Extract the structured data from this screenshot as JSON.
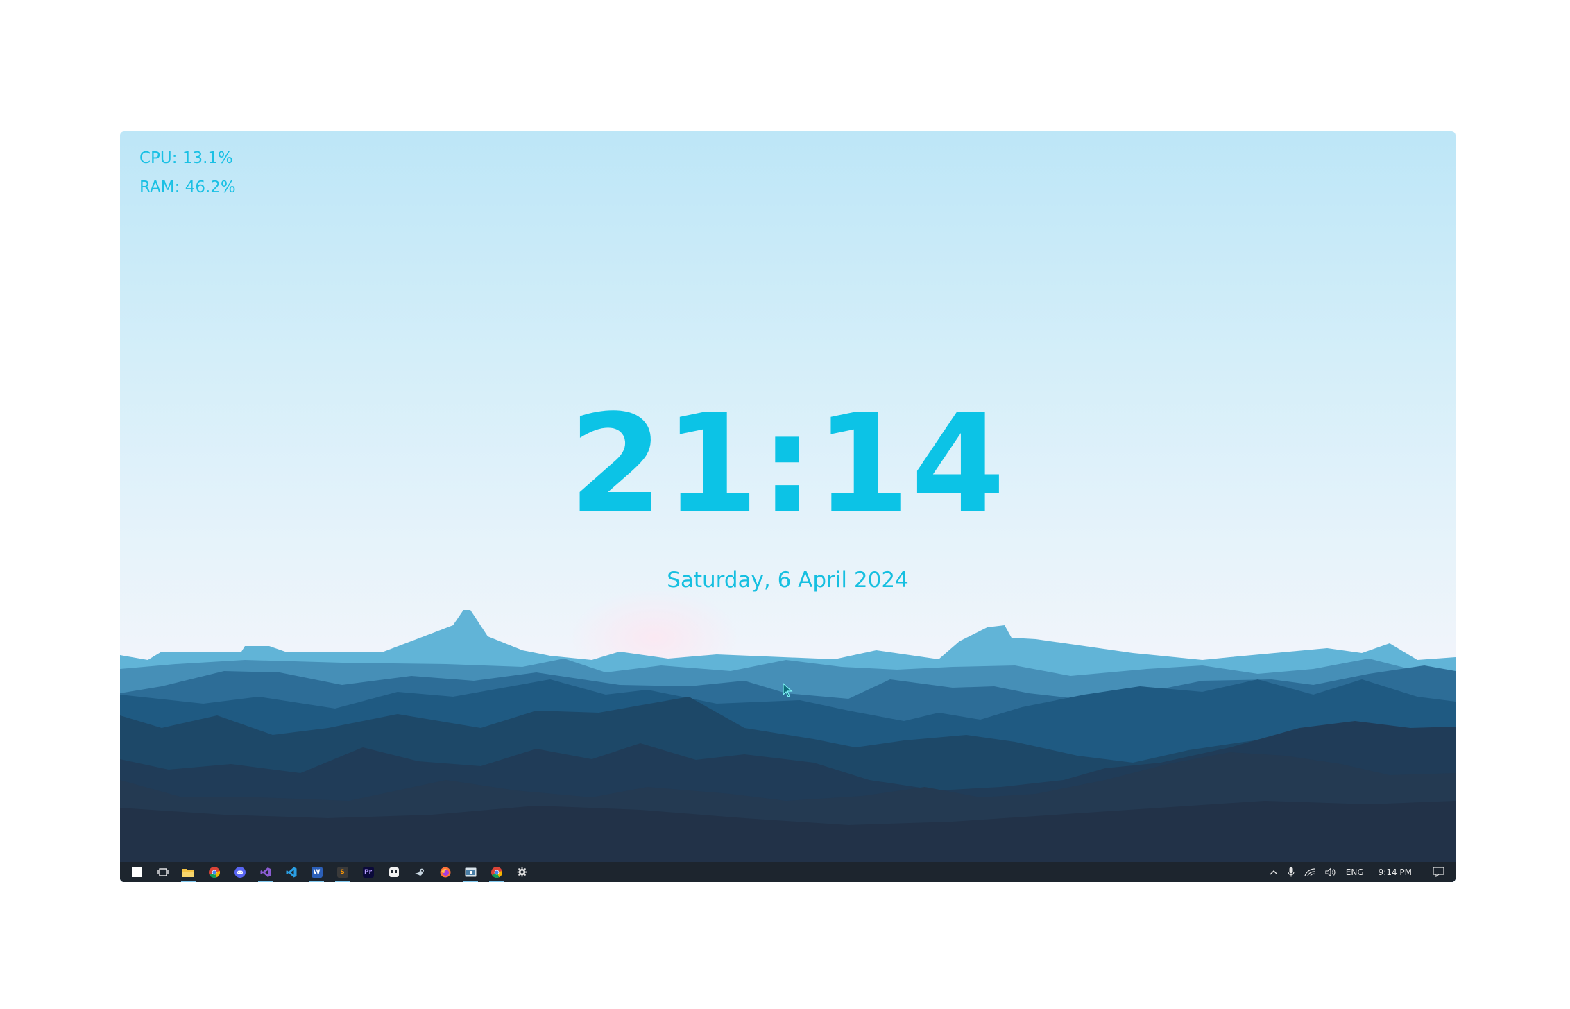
{
  "widgets": {
    "cpu": "CPU: 13.1%",
    "ram": "RAM: 46.2%",
    "time": "21:14",
    "date": "Saturday, 6 April 2024"
  },
  "colors": {
    "accent": "#0cc3e6",
    "taskbar": "#1d252e",
    "active_indicator": "#7fc7ee"
  },
  "taskbar": {
    "start": {
      "icon": "windows-icon"
    },
    "task_view": {
      "icon": "task-view-icon"
    },
    "apps": [
      {
        "icon": "file-explorer-icon",
        "label": "File Explorer",
        "active": true
      },
      {
        "icon": "chrome-icon",
        "label": "Google Chrome",
        "active": false
      },
      {
        "icon": "discord-icon",
        "label": "Discord",
        "active": false
      },
      {
        "icon": "visual-studio-icon",
        "label": "Visual Studio",
        "active": true
      },
      {
        "icon": "vscode-icon",
        "label": "Visual Studio Code",
        "active": false
      },
      {
        "icon": "word-icon",
        "label": "W",
        "active": true
      },
      {
        "icon": "sublime-icon",
        "label": "S",
        "active": true
      },
      {
        "icon": "premiere-icon",
        "label": "Pr",
        "active": false
      },
      {
        "icon": "wallpaper-engine-icon",
        "label": "Wallpaper Engine",
        "active": false
      },
      {
        "icon": "steam-icon",
        "label": "Steam",
        "active": false
      },
      {
        "icon": "firefox-icon",
        "label": "Firefox",
        "active": false
      },
      {
        "icon": "media-icon",
        "label": "Media",
        "active": true
      },
      {
        "icon": "chrome-icon",
        "label": "Google Chrome",
        "active": true
      },
      {
        "icon": "settings-icon",
        "label": "Settings",
        "active": false
      }
    ],
    "tray": {
      "chevron_icon": "chevron-up-icon",
      "mic_icon": "microphone-icon",
      "network_icon": "wifi-icon",
      "volume_icon": "volume-icon",
      "language": "ENG",
      "time": "9:14 PM",
      "notification_icon": "notification-icon"
    }
  }
}
